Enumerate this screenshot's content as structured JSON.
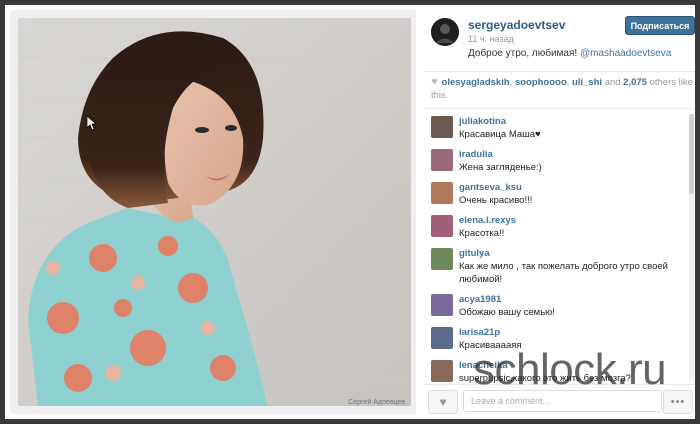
{
  "post": {
    "author": "sergeyadoevtsev",
    "time": "11 ч. назад",
    "caption_text": "Доброе утро, любимая!",
    "caption_mention": "@mashaadoevtseva",
    "follow_label": "Подписаться"
  },
  "likes": {
    "users": [
      "olesyagladskih",
      "soophoooo",
      "uli_shi"
    ],
    "and_text": "and",
    "count": "2,075",
    "others_text": "others like this."
  },
  "comments": [
    {
      "user": "juliakotina",
      "text": "Красавица Маша♥"
    },
    {
      "user": "iradulia",
      "text": "Жена загляденье:)"
    },
    {
      "user": "gantseva_ksu",
      "text": "Очень красиво!!!"
    },
    {
      "user": "elena.l.rexys",
      "text": "Красотка!!"
    },
    {
      "user": "gitulya",
      "text": "Как же мило , так пожелать доброго утро своей любимой!"
    },
    {
      "user": "acya1981",
      "text": "Обожаю вашу семью!"
    },
    {
      "user": "larisa21p",
      "text": "Красивааааяя"
    },
    {
      "user": "lenacheika",
      "text": "superpupsic,какого это жить без мозга?"
    }
  ],
  "footer": {
    "comment_placeholder": "Leave a comment..."
  },
  "photo": {
    "credit": "Сергей Адоевцев"
  },
  "watermark": "schlock.ru",
  "colors": {
    "link": "#3f729b",
    "username": "#2c5c89",
    "follow_button": "#3f729b"
  }
}
